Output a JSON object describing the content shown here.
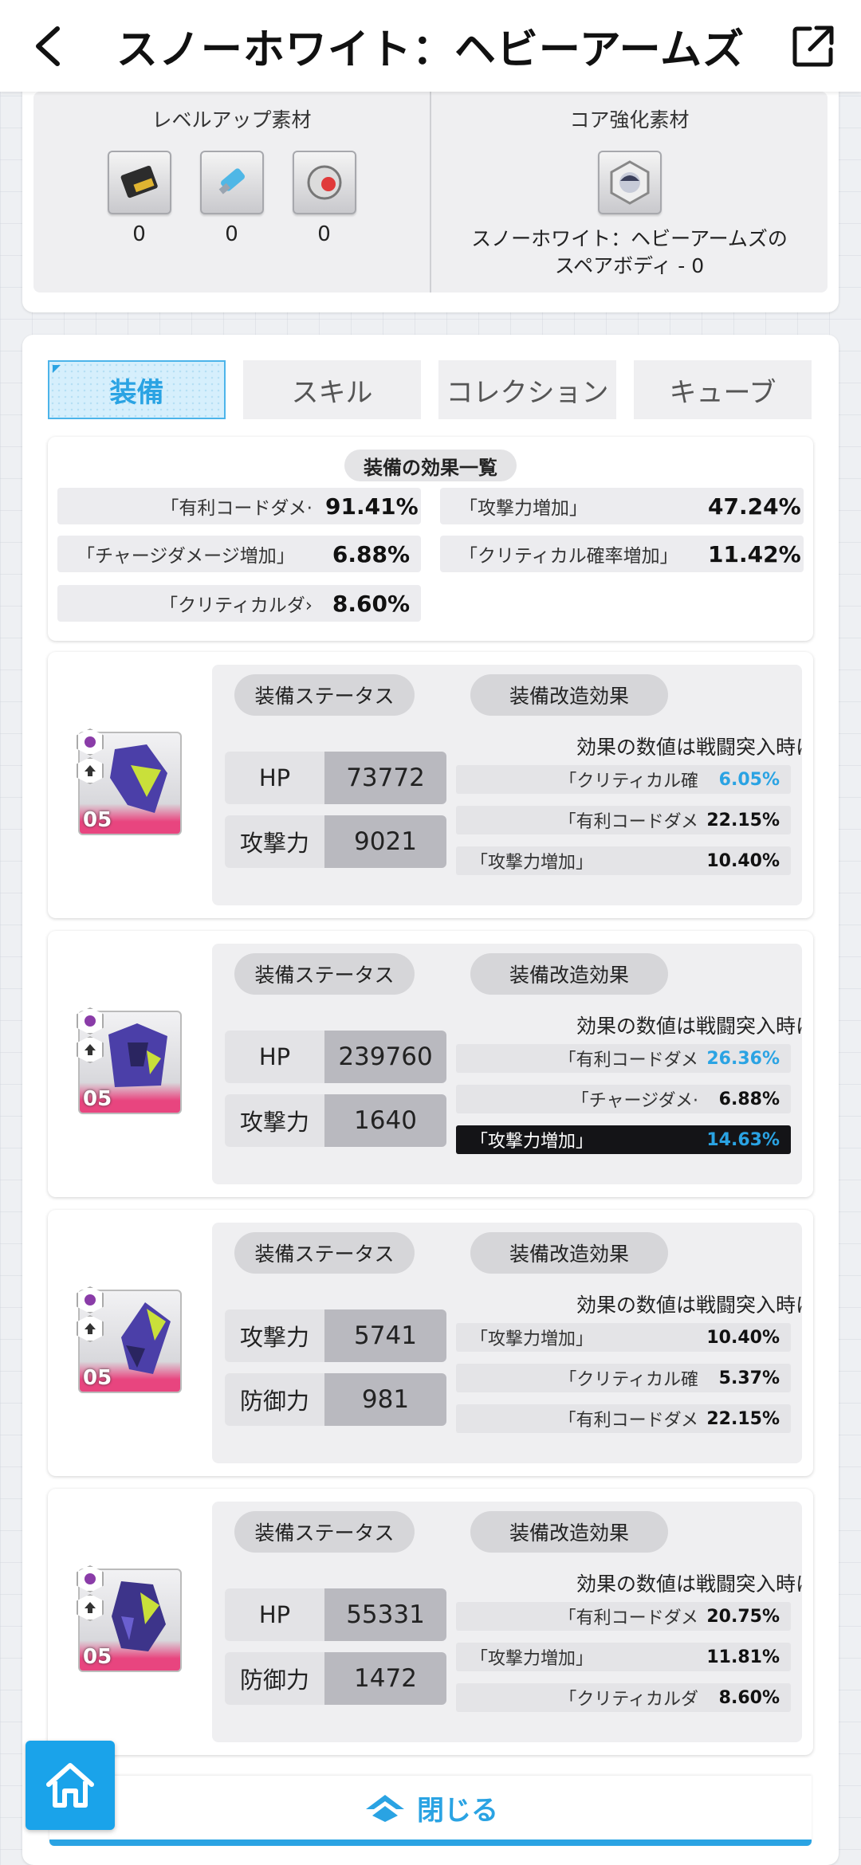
{
  "header": {
    "title": "スノーホワイト：ヘビーアームズ"
  },
  "materials": {
    "levelup_title": "レベルアップ素材",
    "levelup_items": [
      {
        "icon": "card-chip-icon",
        "count": "0"
      },
      {
        "icon": "usb-drive-icon",
        "count": "0"
      },
      {
        "icon": "core-orb-icon",
        "count": "0"
      }
    ],
    "core_title": "コア強化素材",
    "core_caption": "スノーホワイト：ヘビーアームズのスペアボディ - 0"
  },
  "tabs": [
    {
      "label": "装備",
      "active": true
    },
    {
      "label": "スキル",
      "active": false
    },
    {
      "label": "コレクション",
      "active": false
    },
    {
      "label": "キューブ",
      "active": false
    }
  ],
  "effects_summary": {
    "title": "装備の効果一覧",
    "items": [
      {
        "name": "「有利コードダメ·",
        "value": "91.41%"
      },
      {
        "name": "「攻撃力増加」",
        "value": "47.24%"
      },
      {
        "name": "「チャージダメージ増加」",
        "value": "6.88%"
      },
      {
        "name": "「クリティカル確率増加」",
        "value": "11.42%"
      },
      {
        "name": "「クリティカルダ›",
        "value": "8.60%"
      }
    ]
  },
  "equipment": [
    {
      "level": "05",
      "status_label": "装備ステータス",
      "mod_label": "装備改造効果",
      "note": "効果の数値は戦闘突入時に",
      "stats": [
        {
          "label": "HP",
          "value": "73772"
        },
        {
          "label": "攻撃力",
          "value": "9021"
        }
      ],
      "mods": [
        {
          "name": "「クリティカル確",
          "value": "6.05%",
          "highlight": "blue",
          "dark": false
        },
        {
          "name": "「有利コードダメ",
          "value": "22.15%",
          "highlight": "",
          "dark": false
        },
        {
          "name": "「攻撃力増加」",
          "value": "10.40%",
          "highlight": "",
          "dark": false
        }
      ]
    },
    {
      "level": "05",
      "status_label": "装備ステータス",
      "mod_label": "装備改造効果",
      "note": "効果の数値は戦闘突入時に",
      "stats": [
        {
          "label": "HP",
          "value": "239760"
        },
        {
          "label": "攻撃力",
          "value": "1640"
        }
      ],
      "mods": [
        {
          "name": "「有利コードダメ",
          "value": "26.36%",
          "highlight": "blue",
          "dark": false
        },
        {
          "name": "「チャージダメ·",
          "value": "6.88%",
          "highlight": "",
          "dark": false
        },
        {
          "name": "「攻撃力増加」",
          "value": "14.63%",
          "highlight": "blue",
          "dark": true
        }
      ]
    },
    {
      "level": "05",
      "status_label": "装備ステータス",
      "mod_label": "装備改造効果",
      "note": "効果の数値は戦闘突入時に",
      "stats": [
        {
          "label": "攻撃力",
          "value": "5741"
        },
        {
          "label": "防御力",
          "value": "981"
        }
      ],
      "mods": [
        {
          "name": "「攻撃力増加」",
          "value": "10.40%",
          "highlight": "",
          "dark": false
        },
        {
          "name": "「クリティカル確",
          "value": "5.37%",
          "highlight": "",
          "dark": false
        },
        {
          "name": "「有利コードダメ",
          "value": "22.15%",
          "highlight": "",
          "dark": false
        }
      ]
    },
    {
      "level": "05",
      "status_label": "装備ステータス",
      "mod_label": "装備改造効果",
      "note": "効果の数値は戦闘突入時に",
      "stats": [
        {
          "label": "HP",
          "value": "55331"
        },
        {
          "label": "防御力",
          "value": "1472"
        }
      ],
      "mods": [
        {
          "name": "「有利コードダメ",
          "value": "20.75%",
          "highlight": "",
          "dark": false
        },
        {
          "name": "「攻撃力増加」",
          "value": "11.81%",
          "highlight": "",
          "dark": false
        },
        {
          "name": "「クリティカルダ",
          "value": "8.60%",
          "highlight": "",
          "dark": false
        }
      ]
    }
  ],
  "footer": {
    "close_label": "閉じる"
  },
  "colors": {
    "accent": "#2aa3e3",
    "home_button": "#1aa3ea",
    "rarity_pink": "#e8457f"
  }
}
